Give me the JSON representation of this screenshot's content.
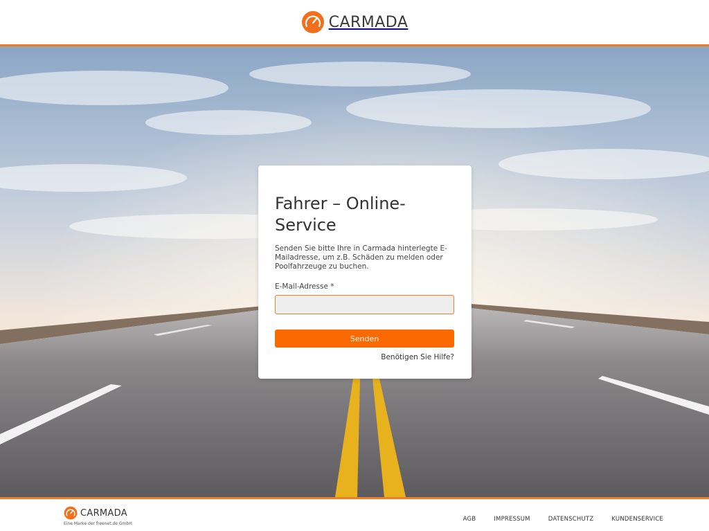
{
  "header": {
    "brand": "CARMADA"
  },
  "card": {
    "title": "Fahrer – Online-Service",
    "description": "Senden Sie bitte Ihre in Carmada hinterlegte E-Mailadresse, um z.B. Schäden zu melden oder Poolfahrzeuge zu buchen.",
    "email_label": "E-Mail-Adresse *",
    "email_value": "",
    "submit_label": "Senden",
    "help_link": "Benötigen Sie Hilfe?"
  },
  "footer": {
    "brand": "CARMADA",
    "tagline": "Eine Marke der freenet.de GmbH",
    "links": [
      "AGB",
      "IMPRESSUM",
      "DATENSCHUTZ",
      "KUNDENSERVICE"
    ]
  },
  "colors": {
    "accent": "#f07d22",
    "button": "#fb6a00",
    "input_bg": "#eeeeee"
  },
  "icons": {
    "logo": "speedometer-icon"
  }
}
